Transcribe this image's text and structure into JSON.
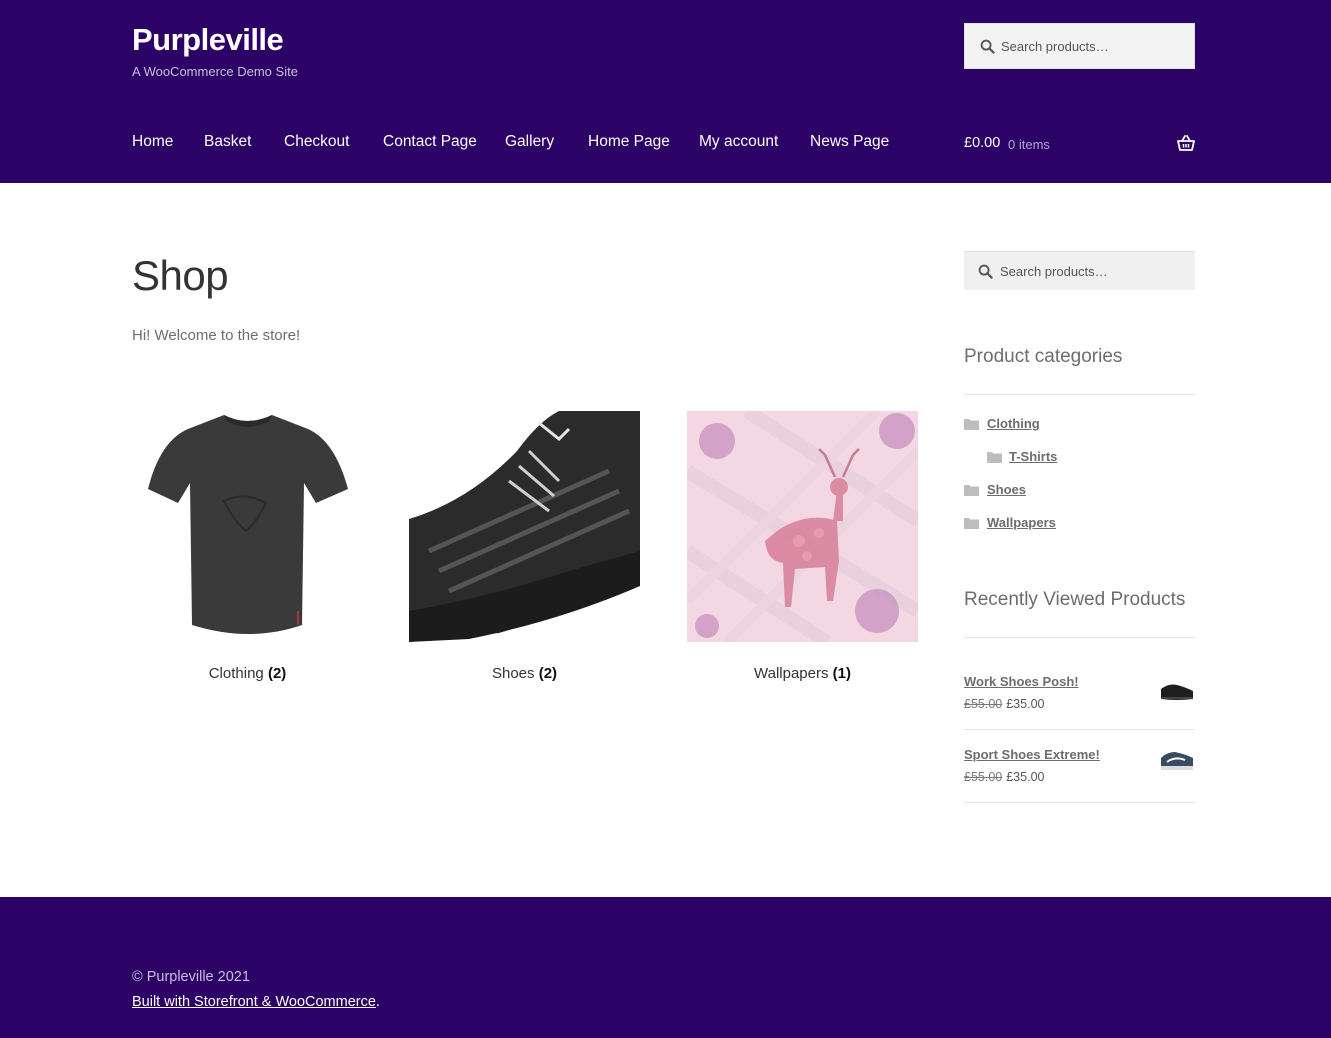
{
  "header": {
    "site_title": "Purpleville",
    "tagline": "A WooCommerce Demo Site",
    "search_placeholder": "Search products…",
    "nav": [
      "Home",
      "Basket",
      "Checkout",
      "Contact Page",
      "Gallery",
      "Home Page",
      "My account",
      "News Page"
    ],
    "cart_amount": "£0.00",
    "cart_count": "0 items"
  },
  "main": {
    "title": "Shop",
    "welcome": "Hi! Welcome to the store!",
    "categories": [
      {
        "name": "Clothing",
        "count": "2"
      },
      {
        "name": "Shoes",
        "count": "2"
      },
      {
        "name": "Wallpapers",
        "count": "1"
      }
    ]
  },
  "sidebar": {
    "search_placeholder": "Search products…",
    "categories_title": "Product categories",
    "categories": [
      "Clothing",
      "T-Shirts",
      "Shoes",
      "Wallpapers"
    ],
    "recent_title": "Recently Viewed Products",
    "recent": [
      {
        "name": "Work Shoes Posh!",
        "old_price": "£55.00",
        "price": "£35.00"
      },
      {
        "name": "Sport Shoes Extreme!",
        "old_price": "£55.00",
        "price": "£35.00"
      }
    ]
  },
  "footer": {
    "copyright": "© Purpleville 2021",
    "built_link": "Built with Storefront & WooCommerce",
    "built_suffix": "."
  },
  "colors": {
    "brand_purple": "#2c0266",
    "text": "#6d6d6d",
    "heading": "#333333"
  }
}
